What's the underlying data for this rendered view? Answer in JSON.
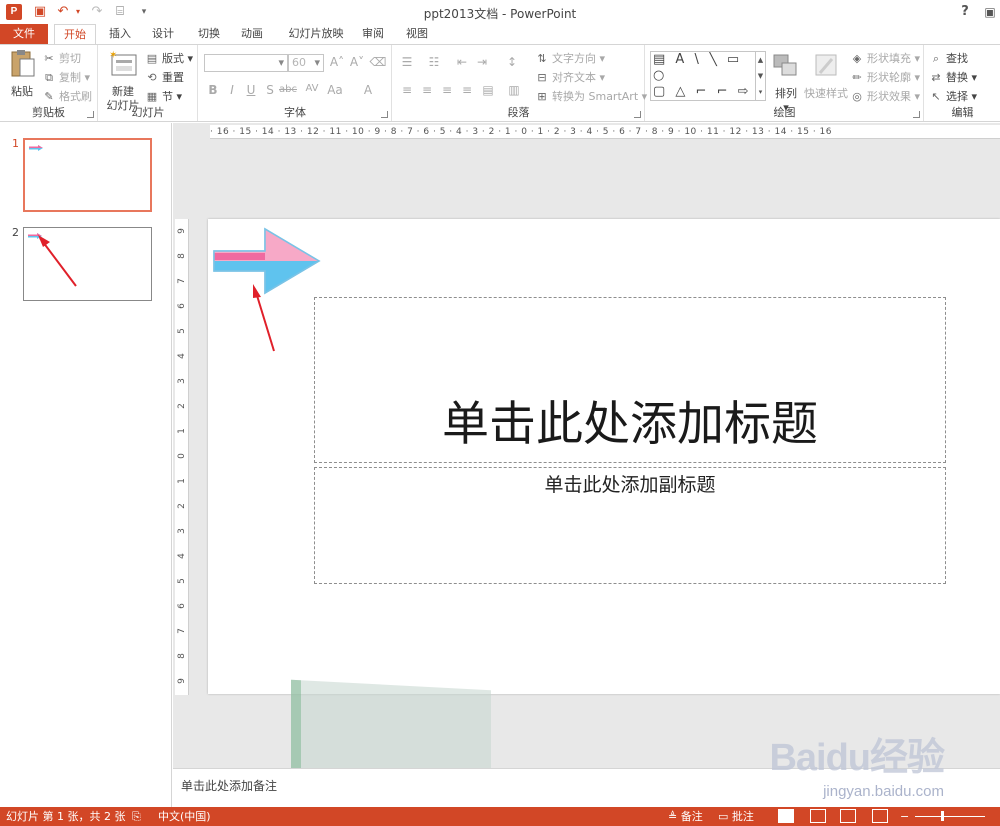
{
  "window": {
    "title": "ppt2013文档 - PowerPoint",
    "app_icon_letter": "P",
    "help": "?",
    "qat_icons": [
      "save-icon",
      "undo-icon",
      "redo-icon",
      "start-from-beginning-icon",
      "customize-qat-icon"
    ]
  },
  "tabs": [
    {
      "label": "文件"
    },
    {
      "label": "开始"
    },
    {
      "label": "插入"
    },
    {
      "label": "设计"
    },
    {
      "label": "切换"
    },
    {
      "label": "动画"
    },
    {
      "label": "幻灯片放映"
    },
    {
      "label": "审阅"
    },
    {
      "label": "视图"
    }
  ],
  "ribbon": {
    "clipboard": {
      "label": "剪贴板",
      "paste": "粘贴",
      "cut": "剪切",
      "copy": "复制",
      "format_painter": "格式刷"
    },
    "slides": {
      "label": "幻灯片",
      "new_slide_line1": "新建",
      "new_slide_line2": "幻灯片",
      "layout": "版式",
      "reset": "重置",
      "section": "节"
    },
    "font": {
      "label": "字体",
      "font_size": "60"
    },
    "paragraph": {
      "label": "段落",
      "text_direction": "文字方向",
      "align_text": "对齐文本",
      "smartart": "转换为 SmartArt"
    },
    "drawing": {
      "label": "绘图",
      "arrange": "排列",
      "quick_styles": "快速样式",
      "shape_fill": "形状填充",
      "shape_outline": "形状轮廓",
      "shape_effects": "形状效果",
      "gallery_row1": "▤ A \\ ╲ ▭ ○",
      "gallery_row2": "▢ △ ⌐ ⌐ ⇨ ⇩",
      "gallery_row3": "⌂ ⌒ ∿ { } ☆"
    },
    "editing": {
      "label": "编辑",
      "find": "查找",
      "replace": "替换",
      "select": "选择"
    }
  },
  "thumbnails": [
    {
      "number": "1",
      "selected": true
    },
    {
      "number": "2",
      "selected": false
    }
  ],
  "ruler": {
    "horizontal": "· 16 · 15 · 14 · 13 · 12 · 11 · 10 · 9 · 8 · 7 · 6 · 5 · 4 · 3 · 2 · 1 · 0 · 1 · 2 · 3 · 4 · 5 · 6 · 7 · 8 · 9 · 10 · 11 · 12 · 13 · 14 · 15 · 16",
    "vertical": [
      "9",
      "8",
      "7",
      "6",
      "5",
      "4",
      "3",
      "2",
      "1",
      "0",
      "1",
      "2",
      "3",
      "4",
      "5",
      "6",
      "7",
      "8",
      "9"
    ]
  },
  "slide": {
    "title_placeholder": "单击此处添加标题",
    "subtitle_placeholder": "单击此处添加副标题",
    "arrow_colors": {
      "pink": "#f06aa0",
      "light_pink": "#f7a9c7",
      "blue": "#5fc3ee",
      "outline": "#7ac3e6"
    }
  },
  "notes": {
    "placeholder": "单击此处添加备注"
  },
  "status": {
    "slide_info": "幻灯片 第 1 张，共 2 张",
    "language": "中文(中国)",
    "notes_btn": "备注",
    "comments_btn": "批注"
  },
  "watermark": {
    "line1": "Baidu经验",
    "line2": "jingyan.baidu.com"
  },
  "colors": {
    "accent": "#d24726",
    "annotation_arrow": "#e0202a"
  }
}
